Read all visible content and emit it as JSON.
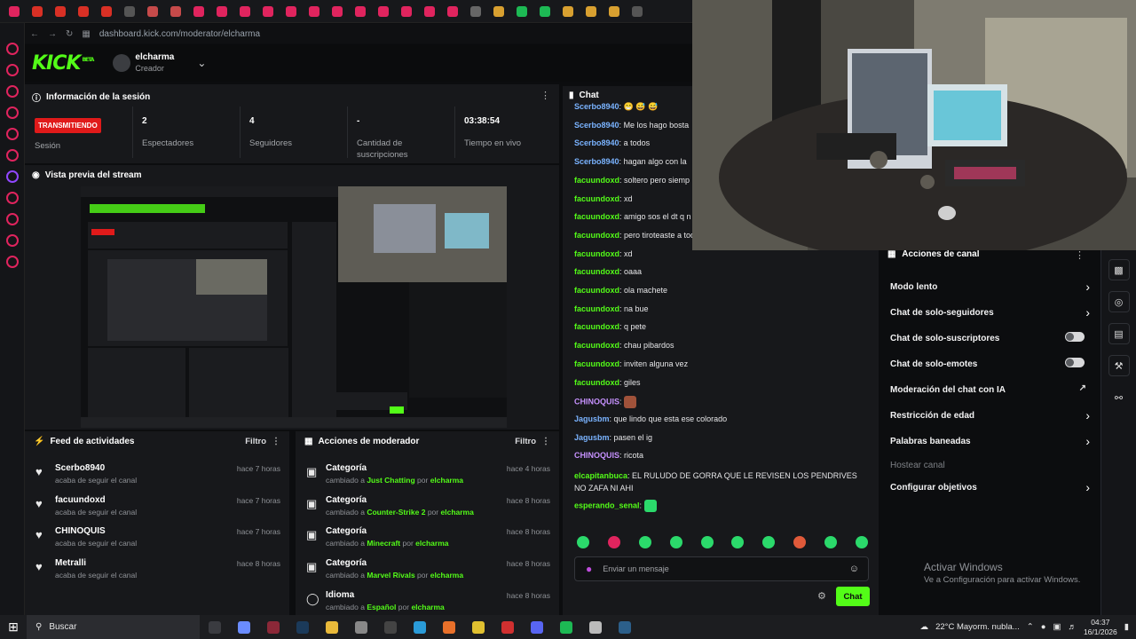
{
  "browser": {
    "url": "dashboard.kick.com/moderator/elcharma",
    "tabs": [
      "kick",
      "gmail",
      "gmail",
      "gmail",
      "gmail",
      "x",
      "ch",
      "ch",
      "yt",
      "yt",
      "yt",
      "yt",
      "yt",
      "yt",
      "yt",
      "yt",
      "yt",
      "yt",
      "yt",
      "yt",
      "gh",
      "ext",
      "gm",
      "gm",
      "ext",
      "ext",
      "ext",
      "x"
    ]
  },
  "header": {
    "logo": "KICK",
    "beta": "BETA",
    "channel_name": "elcharma",
    "channel_role": "Creador"
  },
  "session": {
    "title": "Información de la sesión",
    "badge": "TRANSMITIENDO",
    "stats": [
      {
        "value": "",
        "label": "Sesión"
      },
      {
        "value": "2",
        "label": "Espectadores"
      },
      {
        "value": "4",
        "label": "Seguidores"
      },
      {
        "value": "-",
        "label": "Cantidad de suscripciones"
      },
      {
        "value": "03:38:54",
        "label": "Tiempo en vivo"
      }
    ]
  },
  "preview": {
    "title": "Vista previa del stream"
  },
  "feed": {
    "title": "Feed de actividades",
    "filter": "Filtro",
    "items": [
      {
        "user": "Scerbo8940",
        "action": "acaba de seguir el canal",
        "time": "hace 7 horas"
      },
      {
        "user": "facuundoxd",
        "action": "acaba de seguir el canal",
        "time": "hace 7 horas"
      },
      {
        "user": "CHINOQUIS",
        "action": "acaba de seguir el canal",
        "time": "hace 7 horas"
      },
      {
        "user": "Metralli",
        "action": "acaba de seguir el canal",
        "time": "hace 8 horas"
      }
    ]
  },
  "modactions": {
    "title": "Acciones de moderador",
    "filter": "Filtro",
    "items": [
      {
        "title": "Categoría",
        "prefix": "cambiado a",
        "value": "Just Chatting",
        "by": "por",
        "who": "elcharma",
        "time": "hace 4 horas"
      },
      {
        "title": "Categoría",
        "prefix": "cambiado a",
        "value": "Counter-Strike 2",
        "by": "por",
        "who": "elcharma",
        "time": "hace 8 horas"
      },
      {
        "title": "Categoría",
        "prefix": "cambiado a",
        "value": "Minecraft",
        "by": "por",
        "who": "elcharma",
        "time": "hace 8 horas"
      },
      {
        "title": "Categoría",
        "prefix": "cambiado a",
        "value": "Marvel Rivals",
        "by": "por",
        "who": "elcharma",
        "time": "hace 8 horas"
      },
      {
        "title": "Idioma",
        "prefix": "cambiado a",
        "value": "Español",
        "by": "por",
        "who": "elcharma",
        "time": "hace 8 horas"
      }
    ]
  },
  "chat": {
    "title": "Chat",
    "messages": [
      {
        "user": "Scerbo8940",
        "color": "#7ab3ff",
        "text": "😁 😅 😅"
      },
      {
        "user": "Scerbo8940",
        "color": "#7ab3ff",
        "text": "Me los hago bosta"
      },
      {
        "user": "Scerbo8940",
        "color": "#7ab3ff",
        "text": "a todos"
      },
      {
        "user": "Scerbo8940",
        "color": "#7ab3ff",
        "text": "hagan algo con la"
      },
      {
        "user": "facuundoxd",
        "color": "#53fc18",
        "text": "soltero pero siemp"
      },
      {
        "user": "facuundoxd",
        "color": "#53fc18",
        "text": "xd"
      },
      {
        "user": "facuundoxd",
        "color": "#53fc18",
        "text": "amigo sos el dt q n"
      },
      {
        "user": "facuundoxd",
        "color": "#53fc18",
        "text": "pero tiroteaste a toda tu facu man"
      },
      {
        "user": "facuundoxd",
        "color": "#53fc18",
        "text": "xd"
      },
      {
        "user": "facuundoxd",
        "color": "#53fc18",
        "text": "oaaa"
      },
      {
        "user": "facuundoxd",
        "color": "#53fc18",
        "text": "ola machete"
      },
      {
        "user": "facuundoxd",
        "color": "#53fc18",
        "text": "na bue"
      },
      {
        "user": "facuundoxd",
        "color": "#53fc18",
        "text": "q pete"
      },
      {
        "user": "facuundoxd",
        "color": "#53fc18",
        "text": "chau pibardos"
      },
      {
        "user": "facuundoxd",
        "color": "#53fc18",
        "text": "inviten alguna vez"
      },
      {
        "user": "facuundoxd",
        "color": "#53fc18",
        "text": "giles"
      },
      {
        "user": "CHINOQUIS",
        "color": "#c792ff",
        "text": ""
      },
      {
        "user": "Jagusbm",
        "color": "#7ab3ff",
        "text": "que lindo que esta ese colorado"
      },
      {
        "user": "Jagusbm",
        "color": "#7ab3ff",
        "text": "pasen el ig"
      },
      {
        "user": "CHINOQUIS",
        "color": "#c792ff",
        "text": "ricota"
      },
      {
        "user": "elcapitanbuca",
        "color": "#53fc18",
        "text": "EL RULUDO DE GORRA QUE LE REVISEN LOS PENDRIVES NO ZAFA NI AHI"
      },
      {
        "user": "esperando_senal",
        "color": "#53fc18",
        "text": ""
      }
    ],
    "input_placeholder": "Enviar un mensaje",
    "send_label": "Chat"
  },
  "channel_actions": {
    "title": "Acciones de canal",
    "items": [
      {
        "label": "Modo lento",
        "kind": "chevron"
      },
      {
        "label": "Chat de solo-seguidores",
        "kind": "chevron"
      },
      {
        "label": "Chat de solo-suscriptores",
        "kind": "toggle"
      },
      {
        "label": "Chat de solo-emotes",
        "kind": "toggle"
      },
      {
        "label": "Moderación del chat con IA",
        "kind": "external"
      },
      {
        "label": "Restricción de edad",
        "kind": "chevron"
      },
      {
        "label": "Palabras baneadas",
        "kind": "chevron"
      },
      {
        "label": "Hostear canal",
        "kind": "disabled"
      },
      {
        "label": "Configurar objetivos",
        "kind": "chevron"
      }
    ]
  },
  "windows_watermark": {
    "line1": "Activar Windows",
    "line2": "Ve a Configuración para activar Windows."
  },
  "taskbar": {
    "search": "Buscar",
    "weather": "22°C  Mayorm. nubla...",
    "time": "04:37",
    "date": "16/1/2026"
  },
  "colors": {
    "kick_green": "#53fc18",
    "live_red": "#e01a1a",
    "panel": "#17181b",
    "bg": "#0c0d0f"
  }
}
